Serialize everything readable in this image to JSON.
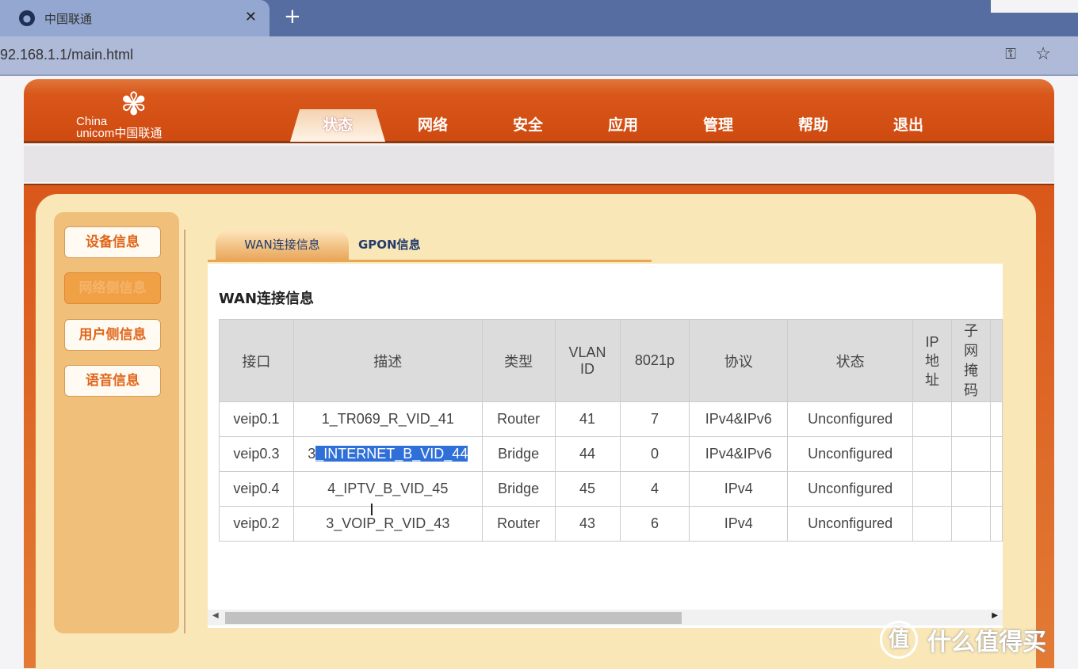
{
  "browser": {
    "tab_title": "中国联通",
    "url": "92.168.1.1/main.html"
  },
  "logo": {
    "en": "China unicom",
    "cn": "中国联通"
  },
  "nav": [
    "状态",
    "网络",
    "安全",
    "应用",
    "管理",
    "帮助",
    "退出"
  ],
  "sidebar": [
    "设备信息",
    "网络侧信息",
    "用户侧信息",
    "语音信息"
  ],
  "subtabs": [
    "WAN连接信息",
    "GPON信息"
  ],
  "section_title": "WAN连接信息",
  "table": {
    "headers": [
      "接口",
      "描述",
      "类型",
      "VLAN ID",
      "8021p",
      "协议",
      "状态",
      "IP地址",
      "子网掩码",
      ""
    ],
    "rows": [
      [
        "veip0.1",
        "1_TR069_R_VID_41",
        "Router",
        "41",
        "7",
        "IPv4&IPv6",
        "Unconfigured"
      ],
      [
        "veip0.3",
        "3_INTERNET_B_VID_44",
        "Bridge",
        "44",
        "0",
        "IPv4&IPv6",
        "Unconfigured"
      ],
      [
        "veip0.4",
        "4_IPTV_B_VID_45",
        "Bridge",
        "45",
        "4",
        "IPv4",
        "Unconfigured"
      ],
      [
        "veip0.2",
        "3_VOIP_R_VID_43",
        "Router",
        "43",
        "6",
        "IPv4",
        "Unconfigured"
      ]
    ]
  },
  "selection": {
    "prefix": "3",
    "selected": "_INTERNET_B_VID_44"
  },
  "watermark": {
    "icon": "值",
    "text": "什么值得买"
  }
}
